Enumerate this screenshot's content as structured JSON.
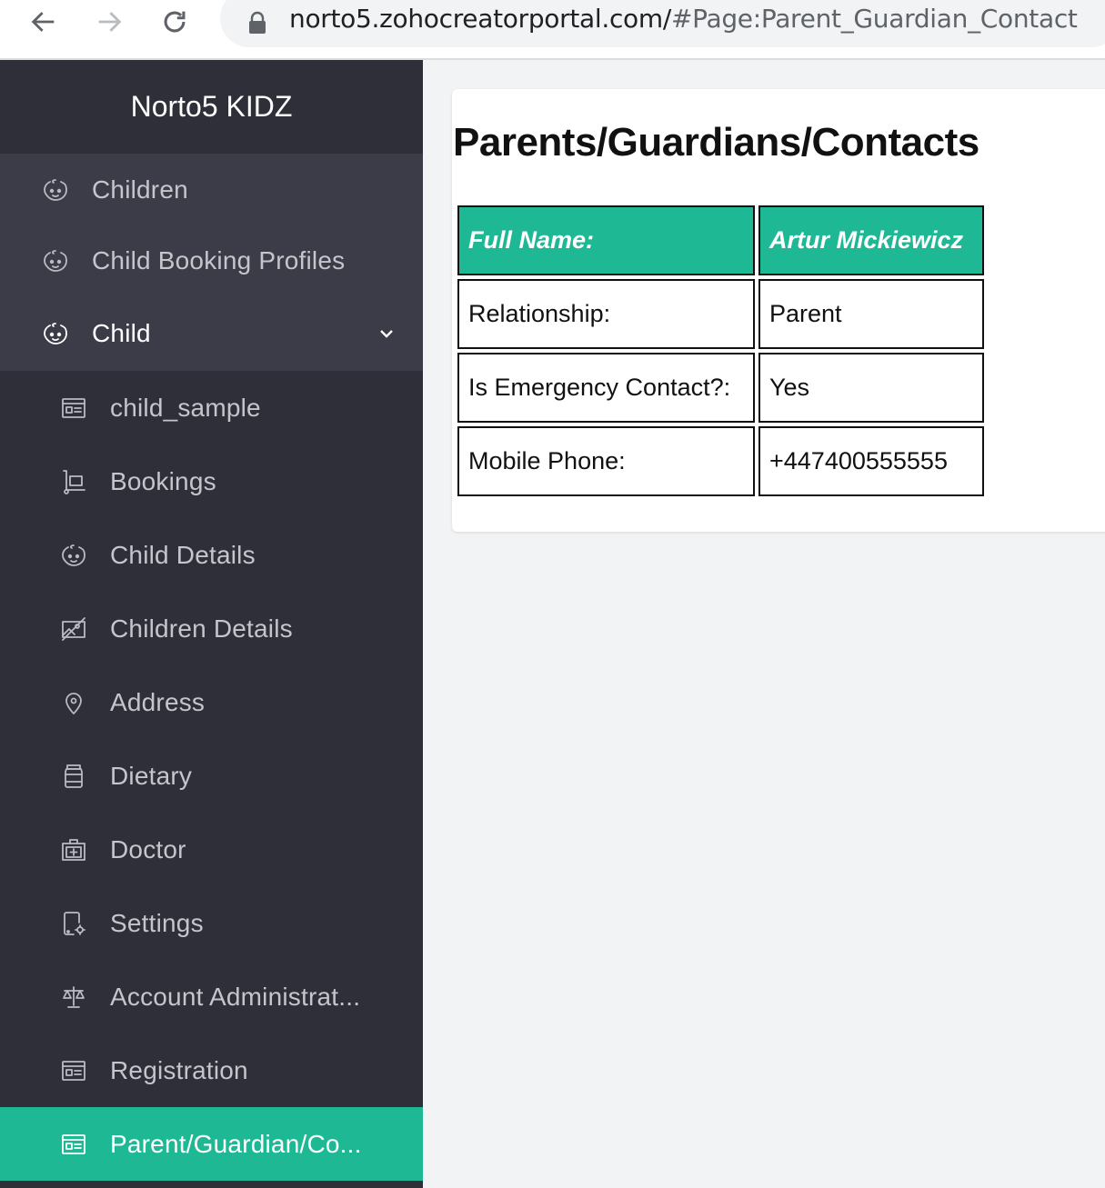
{
  "browser": {
    "url_main": "norto5.zohocreatorportal.com/",
    "url_hash": "#Page:Parent_Guardian_Contact"
  },
  "sidebar": {
    "brand": "Norto5 KIDZ",
    "groups": [
      {
        "label": "Children",
        "icon": "baby-face-icon"
      },
      {
        "label": "Child Booking Profiles",
        "icon": "baby-face-icon"
      },
      {
        "label": "Child",
        "icon": "baby-face-icon",
        "expanded": true
      }
    ],
    "items": [
      {
        "label": "child_sample",
        "icon": "form-icon"
      },
      {
        "label": "Bookings",
        "icon": "trolley-icon"
      },
      {
        "label": "Child Details",
        "icon": "baby-face-icon"
      },
      {
        "label": "Children Details",
        "icon": "image-off-icon"
      },
      {
        "label": "Address",
        "icon": "map-pin-icon"
      },
      {
        "label": "Dietary",
        "icon": "jar-icon"
      },
      {
        "label": "Doctor",
        "icon": "medical-kit-icon"
      },
      {
        "label": "Settings",
        "icon": "device-settings-icon"
      },
      {
        "label": "Account Administrat...",
        "icon": "scales-icon"
      },
      {
        "label": "Registration",
        "icon": "form-icon"
      },
      {
        "label": "Parent/Guardian/Co...",
        "icon": "form-icon",
        "active": true
      }
    ],
    "accent_color": "#1fb894"
  },
  "main": {
    "title": "Parents/Guardians/Contacts",
    "rows": [
      {
        "label": "Full Name:",
        "value": "Artur Mickiewicz",
        "header": true
      },
      {
        "label": "Relationship:",
        "value": "Parent"
      },
      {
        "label": "Is Emergency Contact?:",
        "value": "Yes"
      },
      {
        "label": "Mobile Phone:",
        "value": "+447400555555"
      }
    ]
  }
}
